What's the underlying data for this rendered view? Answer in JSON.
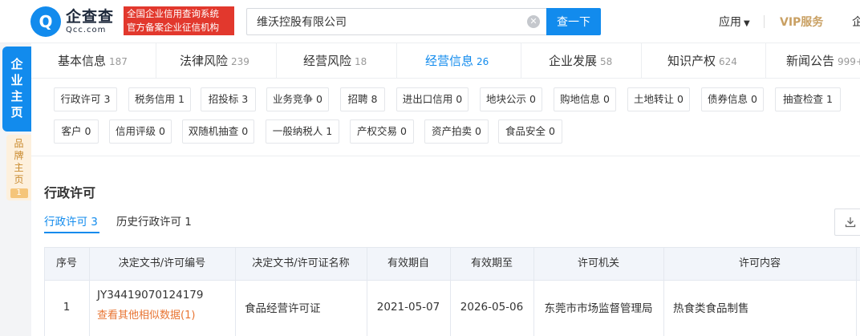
{
  "header": {
    "logo_mark": "Q",
    "logo_cn": "企查查",
    "logo_en": "Qcc.com",
    "tagline_1": "全国企业信用查询系统",
    "tagline_2": "官方备案企业征信机构",
    "search_value": "维沃控股有限公司",
    "search_button": "查一下",
    "nav_app": "应用",
    "nav_vip": "VIP服务",
    "nav_more": "企"
  },
  "side": {
    "main_tab": [
      "企",
      "业",
      "主",
      "页"
    ],
    "brand_tab": [
      "品",
      "牌",
      "主",
      "页"
    ],
    "brand_count": "1"
  },
  "tabs": [
    {
      "label": "基本信息",
      "count": "187"
    },
    {
      "label": "法律风险",
      "count": "239"
    },
    {
      "label": "经营风险",
      "count": "18"
    },
    {
      "label": "经营信息",
      "count": "26",
      "active": true
    },
    {
      "label": "企业发展",
      "count": "58"
    },
    {
      "label": "知识产权",
      "count": "624"
    },
    {
      "label": "新闻公告",
      "count": "999+"
    }
  ],
  "filters_row1": [
    "行政许可 3",
    "税务信用 1",
    "招投标 3",
    "业务竞争 0",
    "招聘 8",
    "进出口信用 0",
    "地块公示 0",
    "购地信息 0",
    "土地转让 0",
    "债券信息 0",
    "抽查检查 1"
  ],
  "filters_row2": [
    "客户 0",
    "信用评级 0",
    "双随机抽查 0",
    "一般纳税人 1",
    "产权交易 0",
    "资产拍卖 0",
    "食品安全 0"
  ],
  "section": {
    "title": "行政许可",
    "subtab_current": "行政许可 3",
    "subtab_history": "历史行政许可 1"
  },
  "table": {
    "headers": [
      "序号",
      "决定文书/许可编号",
      "决定文书/许可证名称",
      "有效期自",
      "有效期至",
      "许可机关",
      "许可内容"
    ],
    "rows": [
      {
        "index": "1",
        "license_no": "JY34419070124179",
        "similar_link": "查看其他相似数据(1)",
        "license_name": "食品经营许可证",
        "valid_from": "2021-05-07",
        "valid_to": "2026-05-06",
        "authority": "东莞市市场监督管理局",
        "content": "热食类食品制售"
      }
    ]
  },
  "colors": {
    "brand_blue": "#128bed",
    "tagline_red": "#e2382d",
    "vip_gold": "#c9a063",
    "link_orange": "#e87533"
  }
}
